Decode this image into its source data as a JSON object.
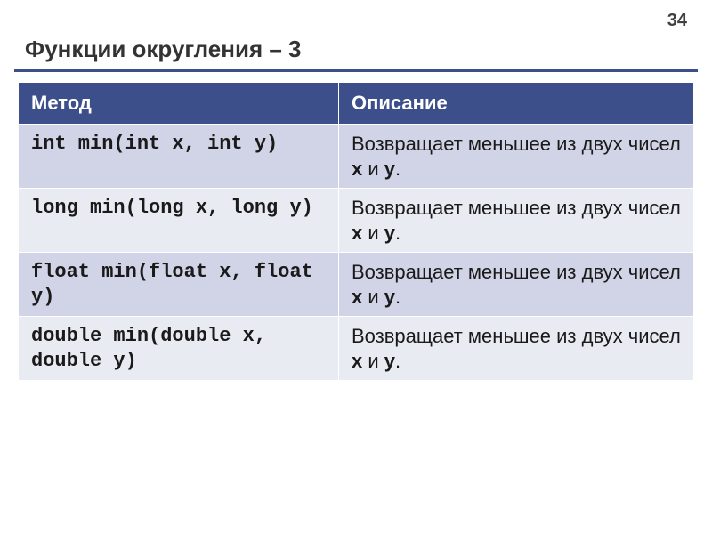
{
  "page_number": "34",
  "title": "Функции округления – 3",
  "header": {
    "method": "Метод",
    "description": "Описание"
  },
  "rows": [
    {
      "method": "int min(int x, int y)",
      "desc_prefix": "Возвращает меньшее из двух чисел ",
      "desc_x": "x",
      "desc_and": " и ",
      "desc_y": "y",
      "desc_suffix": "."
    },
    {
      "method": "long min(long x, long y)",
      "desc_prefix": "Возвращает меньшее из двух чисел ",
      "desc_x": "x",
      "desc_and": " и ",
      "desc_y": "y",
      "desc_suffix": "."
    },
    {
      "method": "float min(float x, float y)",
      "desc_prefix": "Возвращает меньшее из двух чисел ",
      "desc_x": "x",
      "desc_and": " и ",
      "desc_y": "y",
      "desc_suffix": "."
    },
    {
      "method": "double min(double x, double y)",
      "desc_prefix": "Возвращает меньшее из двух чисел ",
      "desc_x": "x",
      "desc_and": " и ",
      "desc_y": "y",
      "desc_suffix": "."
    }
  ]
}
